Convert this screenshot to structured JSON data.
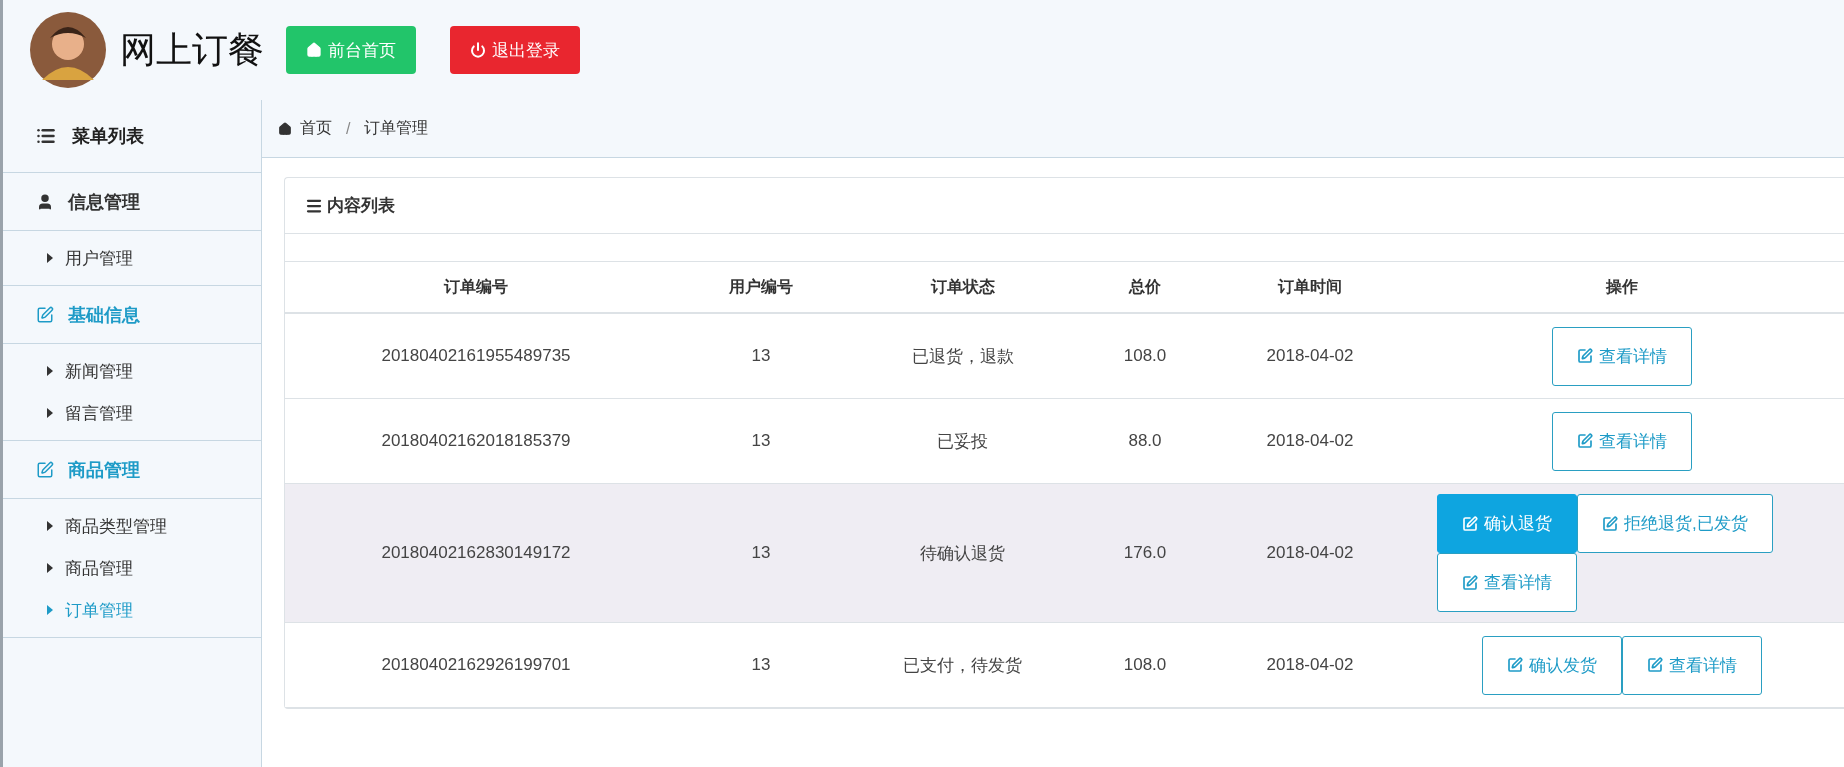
{
  "header": {
    "title": "网上订餐",
    "buttons": [
      {
        "kind": "home",
        "label": "前台首页"
      },
      {
        "kind": "logout",
        "label": "退出登录"
      }
    ]
  },
  "sidebar": {
    "title": "菜单列表",
    "groups": [
      {
        "label": "信息管理",
        "kind": "user",
        "active": false,
        "items": [
          {
            "label": "用户管理",
            "selected": false
          }
        ]
      },
      {
        "label": "基础信息",
        "kind": "edit",
        "active": true,
        "items": [
          {
            "label": "新闻管理",
            "selected": false
          },
          {
            "label": "留言管理",
            "selected": false
          }
        ]
      },
      {
        "label": "商品管理",
        "kind": "edit",
        "active": true,
        "items": [
          {
            "label": "商品类型管理",
            "selected": false
          },
          {
            "label": "商品管理",
            "selected": false
          },
          {
            "label": "订单管理",
            "selected": true
          }
        ]
      }
    ]
  },
  "breadcrumb": {
    "items": [
      "首页",
      "订单管理"
    ],
    "separator": "/"
  },
  "panel": {
    "title": "内容列表"
  },
  "table": {
    "columns": [
      "订单编号",
      "用户编号",
      "订单状态",
      "总价",
      "订单时间",
      "操作"
    ],
    "rows": [
      {
        "hovered": false,
        "cells": [
          "20180402161955489735",
          "13",
          "已退货，退款",
          "108.0",
          "2018-04-02"
        ],
        "actions": [
          {
            "label": "查看详情",
            "active": false
          }
        ]
      },
      {
        "hovered": false,
        "cells": [
          "20180402162018185379",
          "13",
          "已妥投",
          "88.0",
          "2018-04-02"
        ],
        "actions": [
          {
            "label": "查看详情",
            "active": false
          }
        ]
      },
      {
        "hovered": true,
        "cells": [
          "20180402162830149172",
          "13",
          "待确认退货",
          "176.0",
          "2018-04-02"
        ],
        "actions": [
          {
            "label": "确认退货",
            "active": true
          },
          {
            "label": "拒绝退货,已发货",
            "active": false
          },
          {
            "label": "查看详情",
            "active": false
          }
        ]
      },
      {
        "hovered": false,
        "cells": [
          "20180402162926199701",
          "13",
          "已支付，待发货",
          "108.0",
          "2018-04-02"
        ],
        "actions": [
          {
            "label": "确认发货",
            "active": false
          },
          {
            "label": "查看详情",
            "active": false
          }
        ]
      }
    ]
  }
}
